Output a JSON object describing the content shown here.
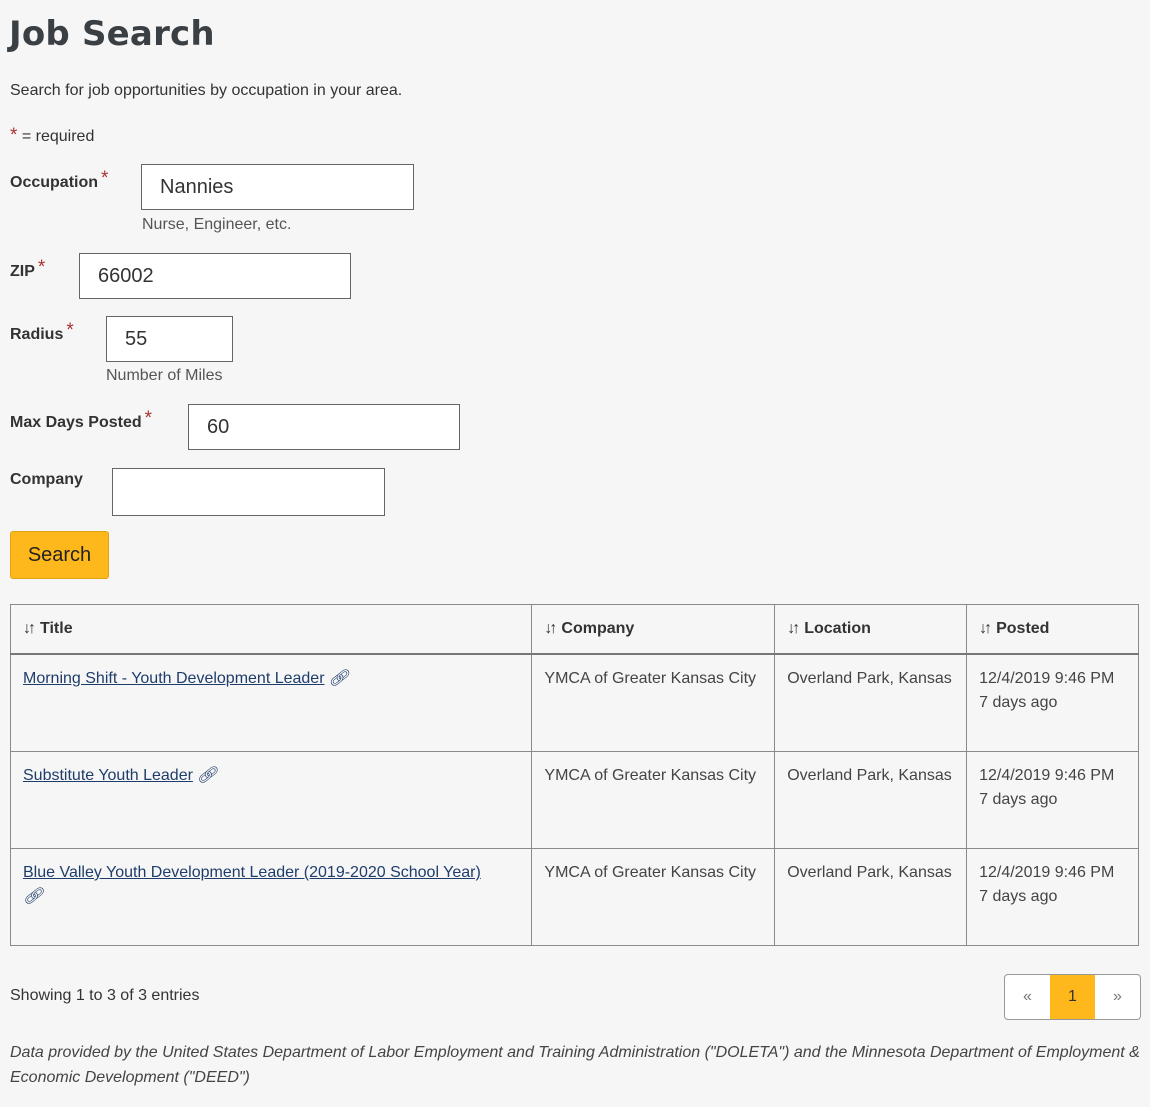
{
  "page": {
    "title": "Job Search",
    "intro": "Search for job opportunities by occupation in your area.",
    "required_star": "*",
    "required_note": " = required"
  },
  "form": {
    "occupation": {
      "label": "Occupation",
      "value": "Nannies",
      "help": "Nurse, Engineer, etc."
    },
    "zip": {
      "label": "ZIP",
      "value": "66002"
    },
    "radius": {
      "label": "Radius",
      "value": "55",
      "help": "Number of Miles"
    },
    "max_days": {
      "label": "Max Days Posted",
      "value": "60"
    },
    "company": {
      "label": "Company",
      "value": ""
    },
    "search_label": "Search"
  },
  "table": {
    "sort_icon": "↓↑",
    "headers": [
      "Title",
      "Company",
      "Location",
      "Posted"
    ],
    "rows": [
      {
        "title": "Morning Shift - Youth Development Leader",
        "company": "YMCA of Greater Kansas City",
        "location": "Overland Park, Kansas",
        "posted": "12/4/2019 9:46 PM",
        "ago": "7 days ago"
      },
      {
        "title": "Substitute Youth Leader",
        "company": "YMCA of Greater Kansas City",
        "location": "Overland Park, Kansas",
        "posted": "12/4/2019 9:46 PM",
        "ago": "7 days ago"
      },
      {
        "title": "Blue Valley Youth Development Leader (2019-2020 School Year)",
        "company": "YMCA of Greater Kansas City",
        "location": "Overland Park, Kansas",
        "posted": "12/4/2019 9:46 PM",
        "ago": "7 days ago"
      }
    ],
    "link_icon": "link-icon"
  },
  "pagination": {
    "showing": "Showing 1 to 3 of 3 entries",
    "prev": "«",
    "current": "1",
    "next": "»"
  },
  "footnote": "Data provided by the United States Department of Labor Employment and Training Administration (\"DOLETA\") and the Minnesota Department of Employment & Economic Development (\"DEED\")",
  "colors": {
    "accent": "#ffb81c",
    "required": "#a33333",
    "link": "#1f3d6b"
  }
}
